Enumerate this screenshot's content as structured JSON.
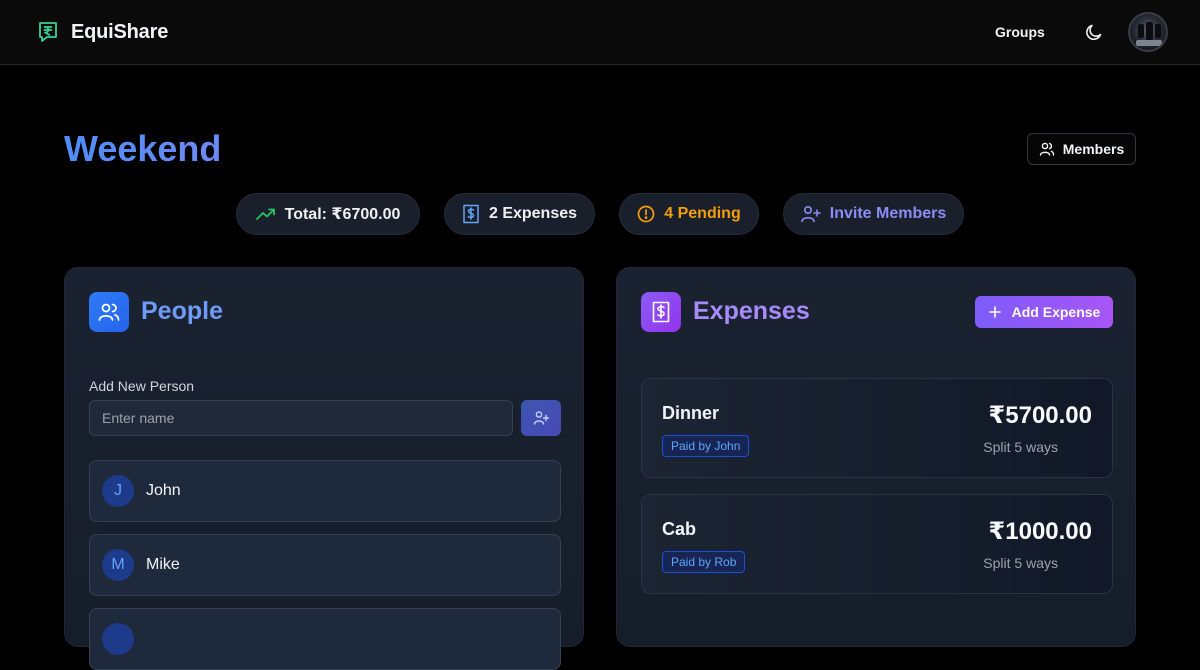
{
  "app": {
    "name": "EquiShare",
    "logo_icon": "rupee-chat-icon"
  },
  "nav": {
    "groups_label": "Groups",
    "theme_icon": "moon-icon",
    "avatar_icon": "user-avatar"
  },
  "group": {
    "title": "Weekend",
    "members_label": "Members"
  },
  "stats": {
    "total_label": "Total: ₹6700.00",
    "expenses_label": "2 Expenses",
    "pending_label": "4 Pending",
    "invite_label": "Invite Members"
  },
  "people": {
    "title": "People",
    "add_label": "Add New Person",
    "input_placeholder": "Enter name",
    "list": [
      {
        "initial": "J",
        "name": "John"
      },
      {
        "initial": "M",
        "name": "Mike"
      }
    ]
  },
  "expenses": {
    "title": "Expenses",
    "add_label": "Add Expense",
    "list": [
      {
        "name": "Dinner",
        "paid_by": "Paid by John",
        "amount": "₹5700.00",
        "split": "Split 5 ways"
      },
      {
        "name": "Cab",
        "paid_by": "Paid by Rob",
        "amount": "₹1000.00",
        "split": "Split 5 ways"
      }
    ]
  },
  "colors": {
    "accent_blue": "#4f8df6",
    "accent_purple": "#a855f7",
    "pending": "#f59e0b",
    "success": "#22c55e",
    "invite": "#8b8cf6"
  }
}
